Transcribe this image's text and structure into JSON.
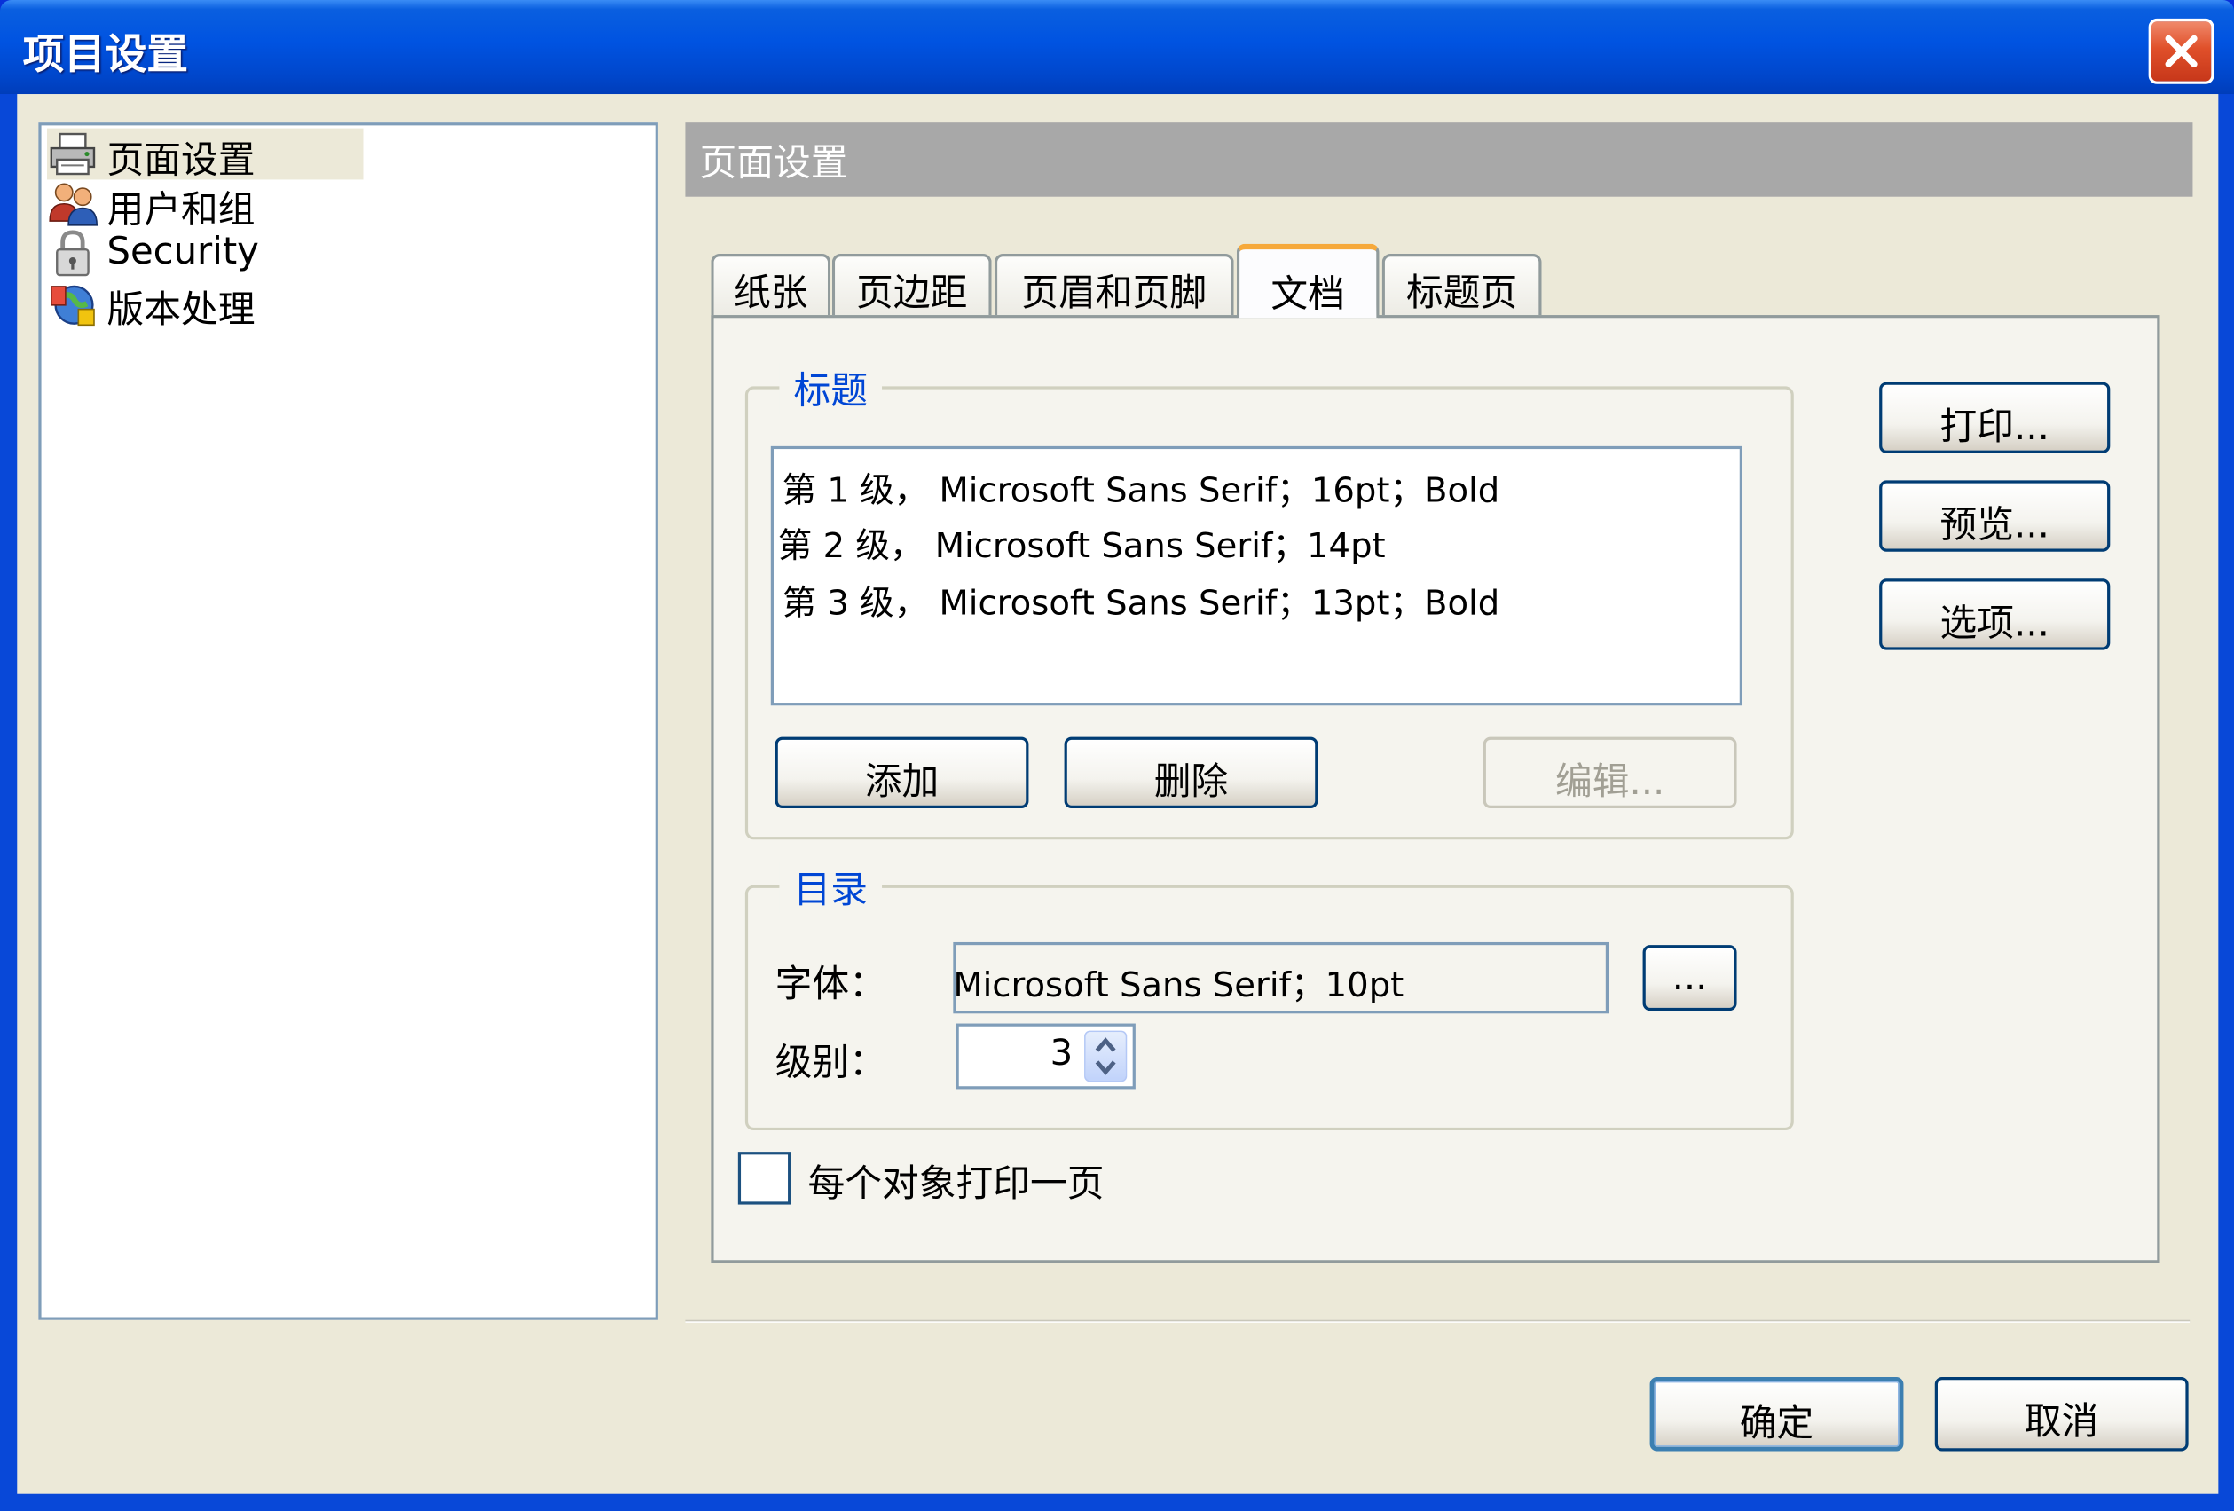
{
  "window": {
    "title": "项目设置"
  },
  "sidebar": {
    "items": [
      {
        "label": "页面设置",
        "icon": "printer-icon",
        "selected": true
      },
      {
        "label": "用户和组",
        "icon": "users-icon",
        "selected": false
      },
      {
        "label": "Security",
        "icon": "padlock-icon",
        "selected": false
      },
      {
        "label": "版本处理",
        "icon": "versioning-icon",
        "selected": false
      }
    ]
  },
  "page": {
    "header": "页面设置"
  },
  "tabs": [
    {
      "label": "纸张",
      "active": false
    },
    {
      "label": "页边距",
      "active": false
    },
    {
      "label": "页眉和页脚",
      "active": false
    },
    {
      "label": "文档",
      "active": true
    },
    {
      "label": "标题页",
      "active": false
    }
  ],
  "headings_group": {
    "title": "标题",
    "items": [
      "第 1 级， Microsoft Sans Serif；16pt；Bold",
      "第 2 级， Microsoft Sans Serif；14pt",
      "第 3 级， Microsoft Sans Serif；13pt；Bold"
    ],
    "add_label": "添加",
    "delete_label": "删除",
    "edit_label": "编辑..."
  },
  "toc_group": {
    "title": "目录",
    "font_label": "字体：",
    "font_value": "Microsoft Sans Serif；10pt",
    "browse_label": "...",
    "level_label": "级别：",
    "level_value": "3"
  },
  "checkbox": {
    "label": "每个对象打印一页",
    "checked": false
  },
  "side_buttons": {
    "print": "打印...",
    "preview": "预览...",
    "options": "选项..."
  },
  "footer": {
    "ok": "确定",
    "cancel": "取消"
  },
  "colors": {
    "titlebar": "#0053e1",
    "accent": "#0046d5",
    "tab_highlight": "#f6a93b",
    "close": "#e0502a"
  }
}
